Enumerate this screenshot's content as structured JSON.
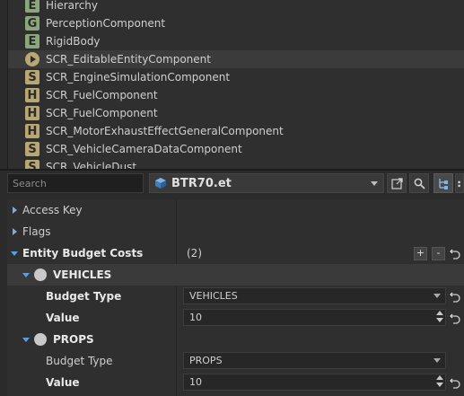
{
  "components": [
    {
      "badge": "E",
      "label": "Hierarchy"
    },
    {
      "badge": "G",
      "label": "PerceptionComponent"
    },
    {
      "badge": "E",
      "label": "RigidBody"
    },
    {
      "badge": "play",
      "label": "SCR_EditableEntityComponent",
      "selected": true
    },
    {
      "badge": "S",
      "label": "SCR_EngineSimulationComponent"
    },
    {
      "badge": "H",
      "label": "SCR_FuelComponent"
    },
    {
      "badge": "H",
      "label": "SCR_FuelComponent"
    },
    {
      "badge": "H",
      "label": "SCR_MotorExhaustEffectGeneralComponent"
    },
    {
      "badge": "S",
      "label": "SCR_VehicleCameraDataComponent"
    },
    {
      "badge": "S",
      "label": "SCR_VehicleDust"
    }
  ],
  "toolbar": {
    "search_placeholder": "Search",
    "file_name": "BTR70.et",
    "open_external_icon": "open-external-icon",
    "search_icon": "search-icon",
    "hierarchy_icon": "hierarchy-icon"
  },
  "properties": {
    "access_key_label": "Access Key",
    "flags_label": "Flags",
    "entity_budget_costs_label": "Entity Budget Costs",
    "entity_budget_costs_count": "(2)",
    "add_label": "+",
    "remove_label": "-",
    "vehicles": {
      "header": "VEHICLES",
      "budget_type_label": "Budget Type",
      "budget_type_value": "VEHICLES",
      "value_label": "Value",
      "value": "10"
    },
    "props": {
      "header": "PROPS",
      "budget_type_label": "Budget Type",
      "budget_type_value": "PROPS",
      "value_label": "Value",
      "value": "10"
    }
  },
  "colors": {
    "background": "#2b2b2b",
    "panel": "#2f2f2f",
    "badge_green": "#8aa77a",
    "badge_gold": "#b9a772",
    "expand_arrow": "#5aa0e0"
  }
}
